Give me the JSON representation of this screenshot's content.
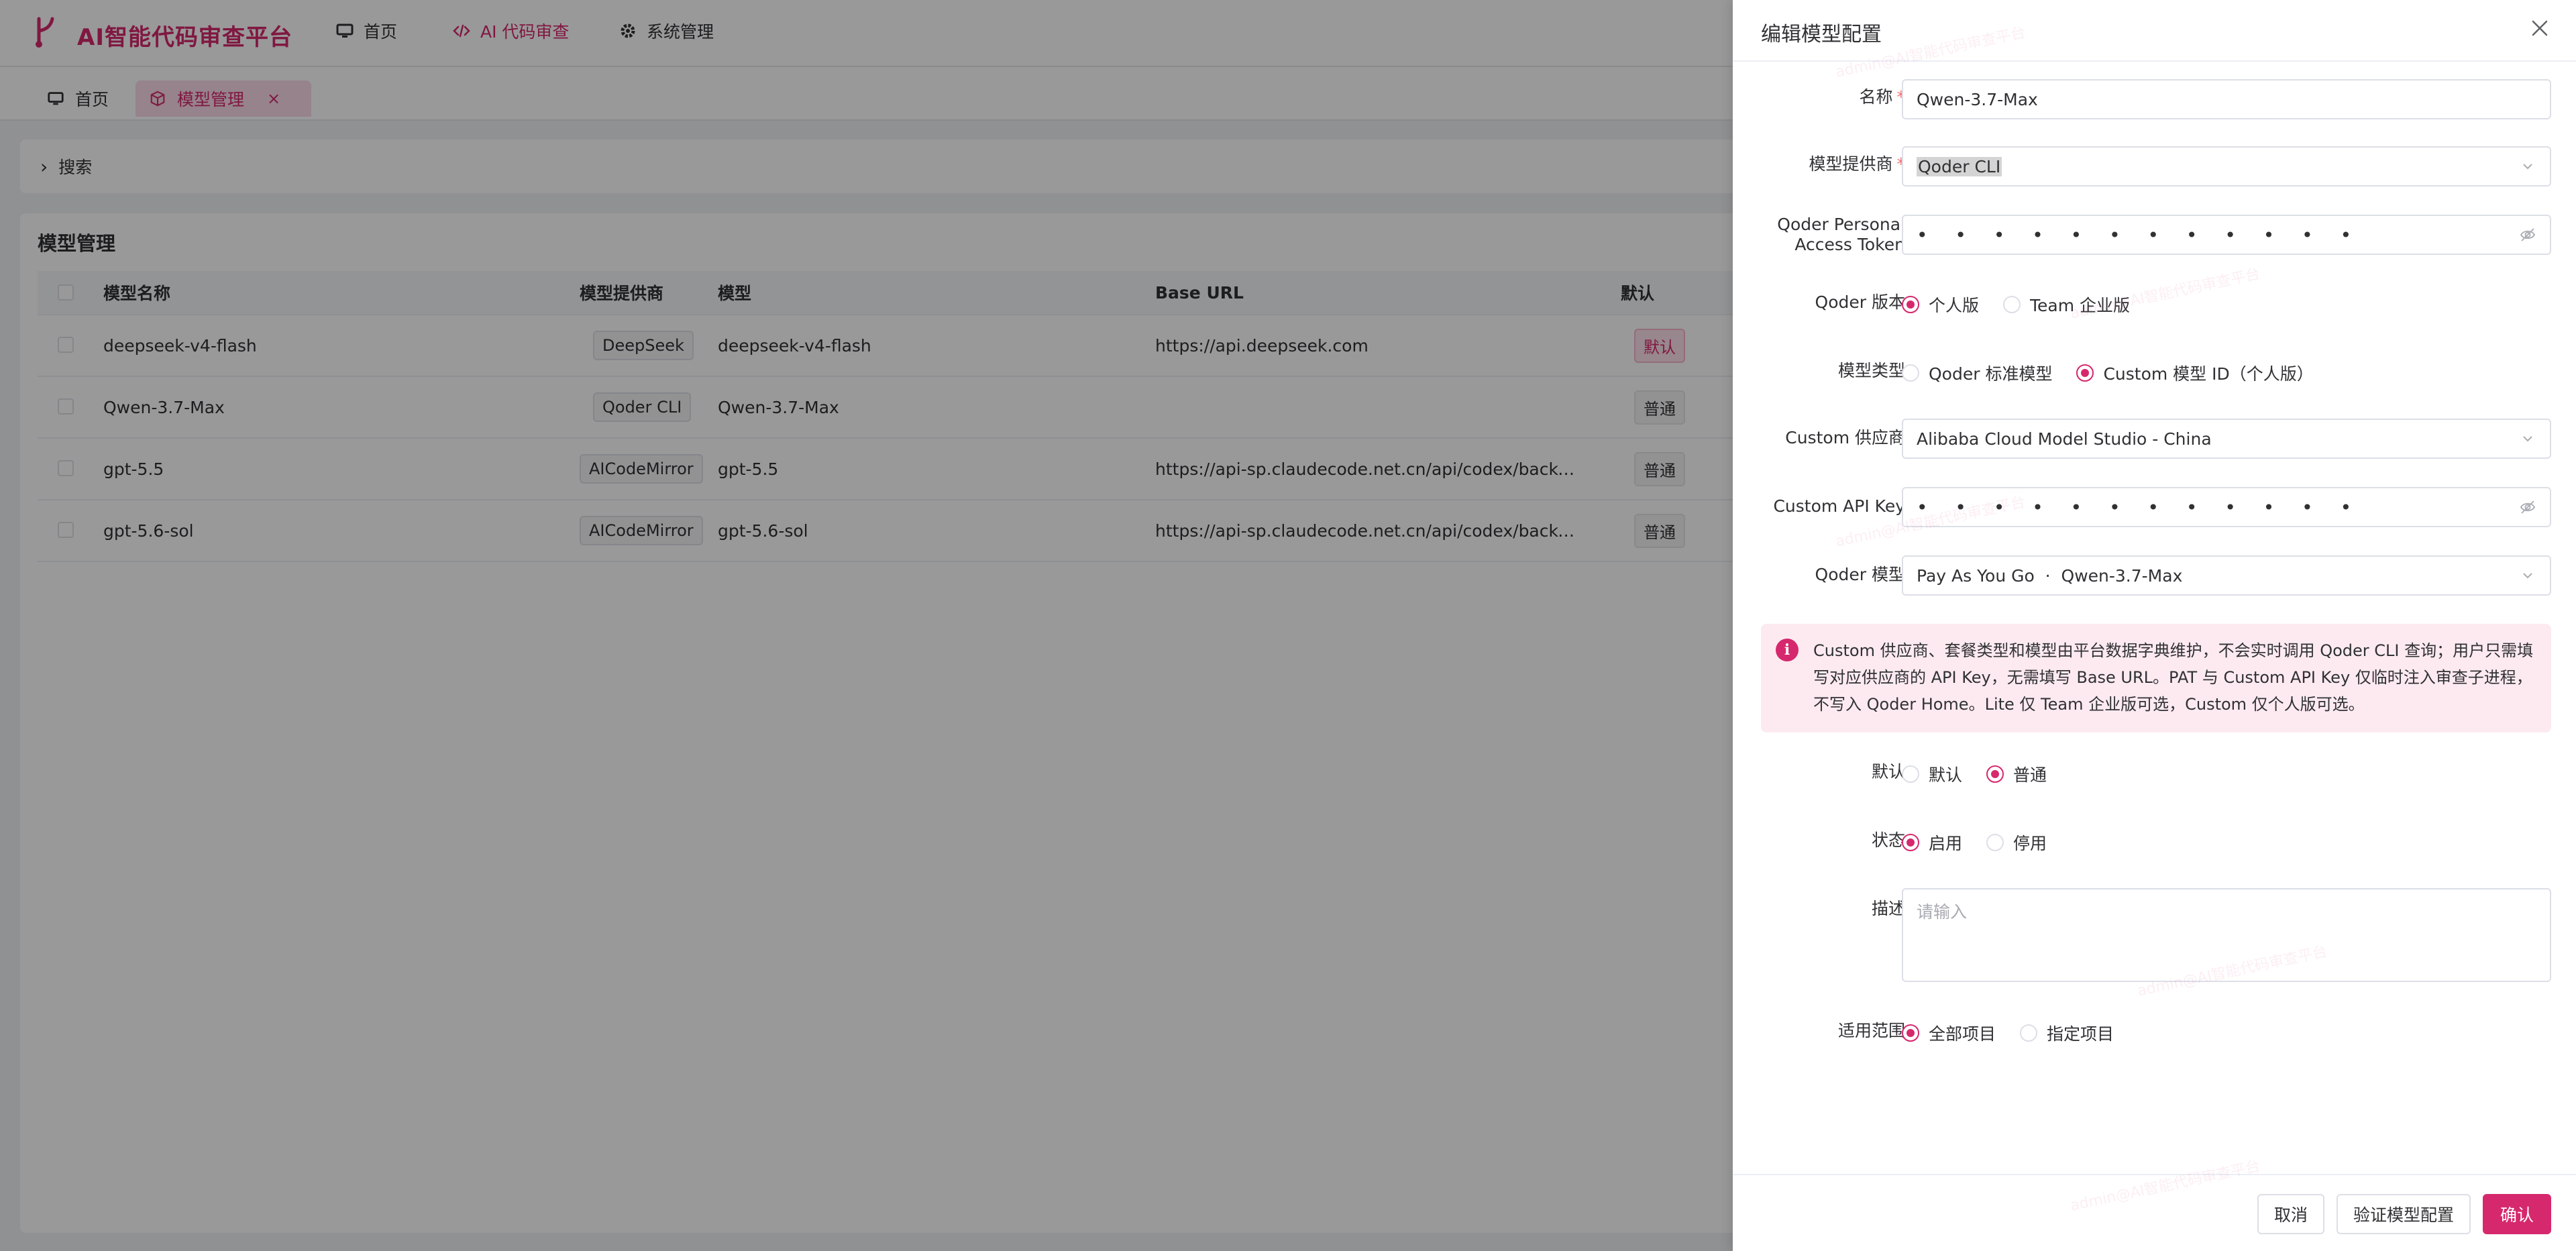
{
  "app": {
    "title": "AI智能代码审查平台",
    "brand_color": "#d6286d"
  },
  "nav": [
    {
      "label": "首页",
      "icon": "monitor-icon"
    },
    {
      "label": "AI 代码审查",
      "icon": "code-icon"
    },
    {
      "label": "系统管理",
      "icon": "gear-icon"
    }
  ],
  "tabs": [
    {
      "label": "首页",
      "icon": "monitor-icon"
    },
    {
      "label": "模型管理",
      "icon": "cube-icon"
    }
  ],
  "search": {
    "label": "搜索"
  },
  "page": {
    "title": "模型管理"
  },
  "table": {
    "headers": {
      "name": "模型名称",
      "provider": "模型提供商",
      "model": "模型",
      "base_url": "Base URL",
      "default": "默认"
    },
    "rows": [
      {
        "name": "deepseek-v4-flash",
        "provider": "DeepSeek",
        "model": "deepseek-v4-flash",
        "base_url": "https://api.deepseek.com",
        "default": "默认"
      },
      {
        "name": "Qwen-3.7-Max",
        "provider": "Qoder CLI",
        "model": "Qwen-3.7-Max",
        "base_url": "",
        "default": "普通"
      },
      {
        "name": "gpt-5.5",
        "provider": "AICodeMirror",
        "model": "gpt-5.5",
        "base_url": "https://api-sp.claudecode.net.cn/api/codex/backend…",
        "default": "普通"
      },
      {
        "name": "gpt-5.6-sol",
        "provider": "AICodeMirror",
        "model": "gpt-5.6-sol",
        "base_url": "https://api-sp.claudecode.net.cn/api/codex/backend…",
        "default": "普通"
      }
    ]
  },
  "drawer": {
    "title": "编辑模型配置",
    "fields": {
      "name": {
        "label": "名称",
        "value": "Qwen-3.7-Max"
      },
      "provider": {
        "label": "模型提供商",
        "value": "Qoder CLI"
      },
      "token": {
        "label1": "Qoder Personal",
        "label2": "Access Token",
        "value": "• • • • • • • • • • • •"
      },
      "edition": {
        "label": "Qoder 版本",
        "options": [
          "个人版",
          "Team 企业版"
        ],
        "selected": 0
      },
      "model_type": {
        "label": "模型类型",
        "options": [
          "Qoder 标准模型",
          "Custom 模型 ID（个人版）"
        ],
        "selected": 1
      },
      "custom_provider": {
        "label": "Custom 供应商",
        "value": "Alibaba Cloud Model Studio - China"
      },
      "custom_key": {
        "label": "Custom API Key",
        "value": "• • • • • • • • • • • •"
      },
      "qoder_model": {
        "label": "Qoder 模型",
        "value": "Pay As You Go  ·  Qwen-3.7-Max"
      },
      "notice": "Custom 供应商、套餐类型和模型由平台数据字典维护，不会实时调用 Qoder CLI 查询；用户只需填写对应供应商的 API Key，无需填写 Base URL。PAT 与 Custom API Key 仅临时注入审查子进程，不写入 Qoder Home。Lite 仅 Team 企业版可选，Custom 仅个人版可选。",
      "default": {
        "label": "默认",
        "options": [
          "默认",
          "普通"
        ],
        "selected": 1
      },
      "status": {
        "label": "状态",
        "options": [
          "启用",
          "停用"
        ],
        "selected": 0
      },
      "description": {
        "label": "描述",
        "placeholder": "请输入"
      },
      "scope": {
        "label": "适用范围",
        "options": [
          "全部项目",
          "指定项目"
        ],
        "selected": 0
      }
    },
    "buttons": {
      "cancel": "取消",
      "verify": "验证模型配置",
      "confirm": "确认"
    }
  },
  "watermark": "admin@AI智能代码审查平台"
}
